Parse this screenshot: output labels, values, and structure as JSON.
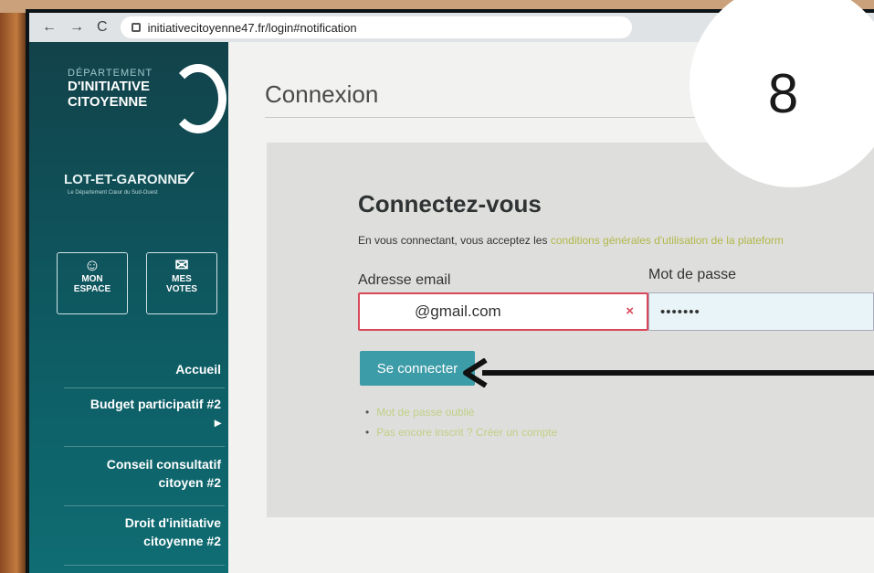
{
  "browser": {
    "url": "initiativecitoyenne47.fr/login#notification"
  },
  "sidebar": {
    "logo": {
      "line1": "DÉPARTEMENT",
      "line2": "D'INITIATIVE",
      "line3": "CITOYENNE"
    },
    "department": "LOT-ET-GARONNE",
    "department_sub": "Le Département Cœur du Sud-Ouest",
    "quick_buttons": [
      {
        "label_top": "MON",
        "label_bottom": "ESPACE",
        "icon": "user-icon"
      },
      {
        "label_top": "MES",
        "label_bottom": "VOTES",
        "icon": "ballot-box-icon"
      }
    ],
    "menu": [
      {
        "line1": "Accueil",
        "line2": ""
      },
      {
        "line1": "Budget participatif #2",
        "line2": "▸"
      },
      {
        "line1": "Conseil consultatif",
        "line2": "citoyen #2"
      },
      {
        "line1": "Droit d'initiative",
        "line2": "citoyenne #2"
      }
    ]
  },
  "main": {
    "page_title": "Connexion",
    "panel": {
      "title": "Connectez-vous",
      "note_prefix": "En vous connectant, vous acceptez les",
      "note_link": "conditions générales d'utilisation de la plateform",
      "email_label": "Adresse email",
      "email_value": "@gmail.com",
      "clear_icon": "×",
      "password_label": "Mot de passe",
      "password_value": "•••••••",
      "submit_label": "Se connecter",
      "links": [
        "Mot de passe oublié",
        "Pas encore inscrit ? Créer un compte"
      ]
    }
  },
  "overlay": {
    "step_number": "8"
  }
}
